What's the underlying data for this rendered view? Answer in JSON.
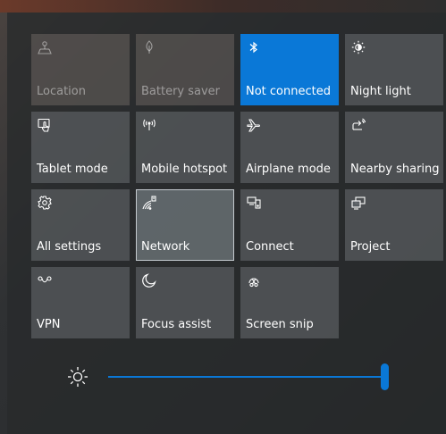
{
  "quick_actions": [
    {
      "label": "Location",
      "icon": "location-icon",
      "state": "disabled"
    },
    {
      "label": "Battery saver",
      "icon": "battery-saver-icon",
      "state": "disabled"
    },
    {
      "label": "Not connected",
      "icon": "bluetooth-icon",
      "state": "active"
    },
    {
      "label": "Night light",
      "icon": "night-light-icon",
      "state": "off"
    },
    {
      "label": "Tablet mode",
      "icon": "tablet-mode-icon",
      "state": "off"
    },
    {
      "label": "Mobile hotspot",
      "icon": "mobile-hotspot-icon",
      "state": "off"
    },
    {
      "label": "Airplane mode",
      "icon": "airplane-icon",
      "state": "off"
    },
    {
      "label": "Nearby sharing",
      "icon": "nearby-sharing-icon",
      "state": "off"
    },
    {
      "label": "All settings",
      "icon": "gear-icon",
      "state": "off"
    },
    {
      "label": "Network",
      "icon": "network-icon",
      "state": "focused"
    },
    {
      "label": "Connect",
      "icon": "connect-icon",
      "state": "off"
    },
    {
      "label": "Project",
      "icon": "project-icon",
      "state": "off"
    },
    {
      "label": "VPN",
      "icon": "vpn-icon",
      "state": "off"
    },
    {
      "label": "Focus assist",
      "icon": "moon-icon",
      "state": "off"
    },
    {
      "label": "Screen snip",
      "icon": "screen-snip-icon",
      "state": "off"
    }
  ],
  "brightness": {
    "icon": "brightness-icon",
    "level_percent": 100
  },
  "colors": {
    "accent": "#0a78d7"
  }
}
